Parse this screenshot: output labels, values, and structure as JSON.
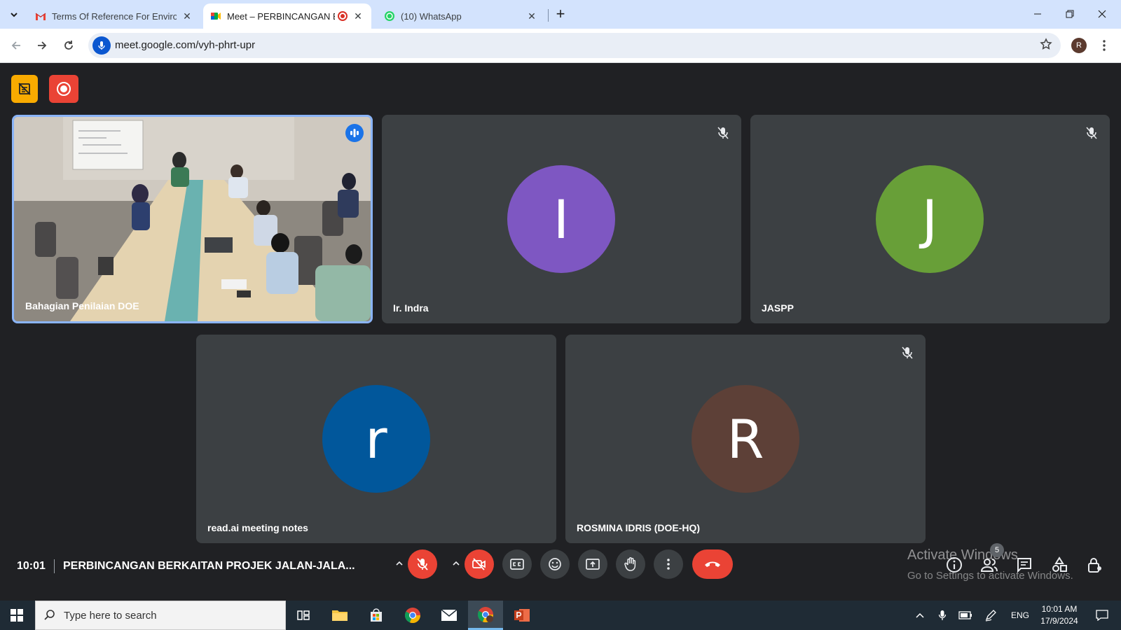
{
  "browser": {
    "tabs": [
      {
        "title": "Terms Of Reference For Environ",
        "active": false
      },
      {
        "title": "Meet – PERBINCANGAN BE",
        "active": true
      },
      {
        "title": "(10) WhatsApp",
        "active": false
      }
    ],
    "url": "meet.google.com/vyh-phrt-upr",
    "profile_initial": "R"
  },
  "meet": {
    "tiles": [
      {
        "name": "Bahagian Penilaian DOE",
        "type": "video"
      },
      {
        "name": "Ir. Indra",
        "initial": "I",
        "color": "#7e57c2",
        "muted": true
      },
      {
        "name": "JASPP",
        "initial": "J",
        "color": "#689f38",
        "muted": true
      },
      {
        "name": "read.ai meeting notes",
        "initial": "r",
        "color": "#01579b",
        "muted": false
      },
      {
        "name": "ROSMINA IDRIS (DOE-HQ)",
        "initial": "R",
        "color": "#5d4037",
        "muted": true
      }
    ],
    "clock": "10:01",
    "meeting_title": "PERBINCANGAN BERKAITAN PROJEK JALAN-JALA...",
    "participants_count": "5",
    "watermark_title": "Activate Windows",
    "watermark_sub": "Go to Settings to activate Windows."
  },
  "taskbar": {
    "search_placeholder": "Type here to search",
    "lang": "ENG",
    "time": "10:01 AM",
    "date": "17/9/2024"
  },
  "colors": {
    "accent": "#1a73e8",
    "danger": "#ea4335",
    "tile_bg": "#3c4043"
  }
}
